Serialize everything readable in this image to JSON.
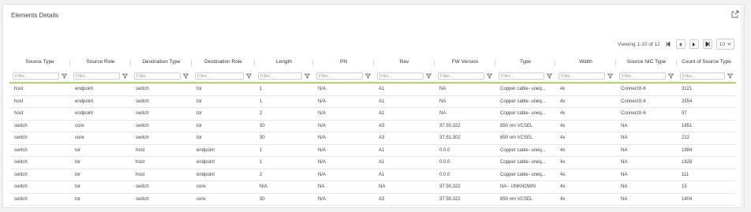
{
  "panel": {
    "title": "Elements Details"
  },
  "pager": {
    "viewing": "Viewing 1-10 of 12",
    "page_size": "10"
  },
  "filter_placeholder": "Filter...",
  "columns": [
    "Source Type",
    "Source Role",
    "Destination Type",
    "Destination Role",
    "Length",
    "PN",
    "Rev",
    "FW Version",
    "Type",
    "Width",
    "Source NIC Type",
    "Count of Source Type"
  ],
  "rows": [
    [
      "host",
      "endpoint",
      "switch",
      "tor",
      "1",
      "N/A",
      "A1",
      "NA",
      "Copper cable- uneq...",
      "4x",
      "ConnectX-6",
      "3121"
    ],
    [
      "host",
      "endpoint",
      "switch",
      "tor",
      "1",
      "N/A",
      "A1",
      "NA",
      "Copper cable- uneq...",
      "4x",
      "ConnectX-6",
      "2554"
    ],
    [
      "host",
      "endpoint",
      "switch",
      "tor",
      "2",
      "N/A",
      "A1",
      "NA",
      "Copper cable- uneq...",
      "4x",
      "ConnectX-6",
      "97"
    ],
    [
      "switch",
      "core",
      "switch",
      "tor",
      "30",
      "N/A",
      "A3",
      "37.50.322",
      "850 nm VCSEL",
      "4x",
      "NA",
      "1851"
    ],
    [
      "switch",
      "core",
      "switch",
      "tor",
      "30",
      "N/A",
      "A3",
      "37.51.302",
      "850 nm VCSEL",
      "4x",
      "NA",
      "212"
    ],
    [
      "switch",
      "tor",
      "host",
      "endpoint",
      "1",
      "N/A",
      "A1",
      "0.0.0",
      "Copper cable- uneq...",
      "4x",
      "NA",
      "1884"
    ],
    [
      "switch",
      "tor",
      "host",
      "endpoint",
      "1",
      "N/A",
      "A1",
      "0.0.0",
      "Copper cable- uneq...",
      "4x",
      "NA",
      "1826"
    ],
    [
      "switch",
      "tor",
      "host",
      "endpoint",
      "2",
      "N/A",
      "A1",
      "0.0.0",
      "Copper cable- uneq...",
      "4x",
      "NA",
      "111"
    ],
    [
      "switch",
      "tor",
      "switch",
      "core",
      "N/A",
      "NA",
      "NA",
      "37.50.322",
      "NA - UNKNOWN",
      "4x",
      "NA",
      "15"
    ],
    [
      "switch",
      "tor",
      "switch",
      "core",
      "30",
      "N/A",
      "A3",
      "37.50.322",
      "850 nm VCSEL",
      "4x",
      "NA",
      "1404"
    ]
  ],
  "colors": {
    "accent": "#b3d36b"
  },
  "icons": {
    "expand": "external-expand-icon",
    "filter": "filter-icon",
    "first": "first-page-icon",
    "prev": "prev-page-icon",
    "next": "next-page-icon",
    "last": "last-page-icon",
    "dropdown": "chevron-down-icon"
  }
}
